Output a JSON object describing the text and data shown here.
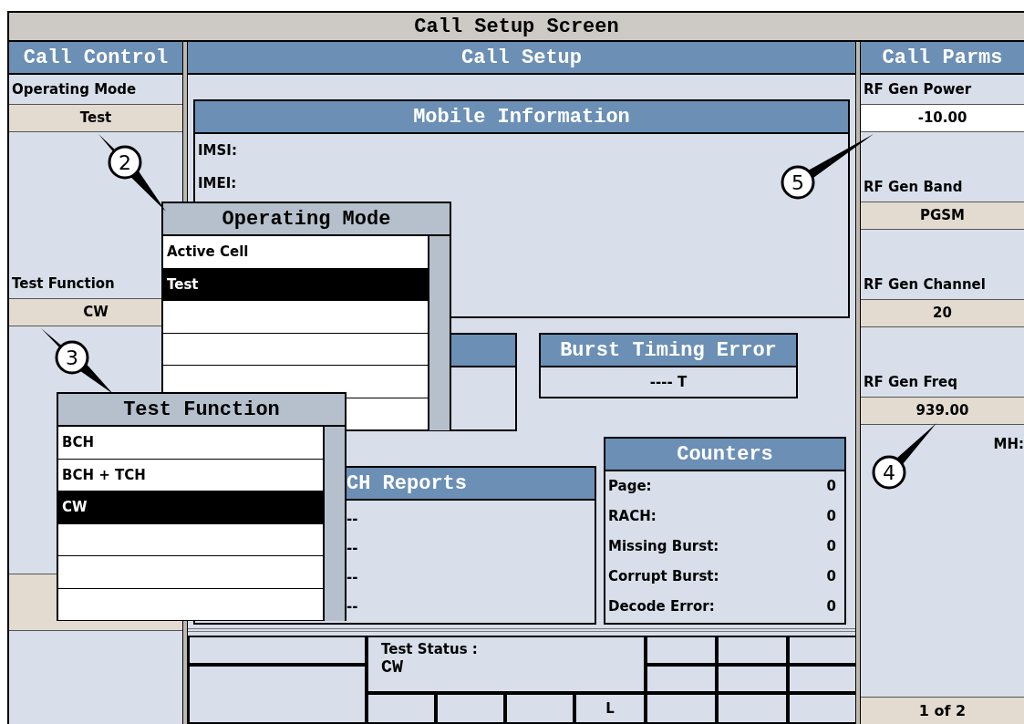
{
  "window": {
    "title": "Call Setup Screen"
  },
  "call_control": {
    "title": "Call Control",
    "fields": [
      {
        "label": "Operating Mode",
        "value": "Test"
      },
      {
        "label": "Test Function",
        "value": "CW"
      }
    ]
  },
  "call_setup": {
    "title": "Call Setup",
    "mobile_information": {
      "title": "Mobile Information",
      "rows": [
        "IMSI:",
        "IMEI:"
      ]
    },
    "burst_timing_error": {
      "title": "Burst Timing Error",
      "value": "---- T"
    },
    "reports": {
      "title": "CH Reports",
      "rows": [
        "--",
        "--",
        "--",
        "--"
      ]
    },
    "counters": {
      "title": "Counters",
      "rows": [
        {
          "label": "Page:",
          "value": "0"
        },
        {
          "label": "RACH:",
          "value": "0"
        },
        {
          "label": "Missing Burst:",
          "value": "0"
        },
        {
          "label": "Corrupt Burst:",
          "value": "0"
        },
        {
          "label": "Decode Error:",
          "value": "0"
        }
      ]
    }
  },
  "status": {
    "label": "Test Status :",
    "value": "CW",
    "indicator": "L"
  },
  "call_parms": {
    "title": "Call Parms",
    "fields": [
      {
        "label": "RF Gen Power",
        "value": "-10.00",
        "active": true
      },
      {
        "label": "RF Gen Band",
        "value": "PGSM",
        "active": false
      },
      {
        "label": "RF Gen Channel",
        "value": "20",
        "active": false
      },
      {
        "label": "RF Gen Freq",
        "value": "939.00",
        "active": false
      }
    ],
    "unit": "MH:",
    "page": "1 of 2"
  },
  "popups": [
    {
      "title": "Operating Mode",
      "options": [
        {
          "label": "Active Cell",
          "selected": false
        },
        {
          "label": "Test",
          "selected": true
        }
      ]
    },
    {
      "title": "Test Function",
      "options": [
        {
          "label": "BCH",
          "selected": false
        },
        {
          "label": "BCH + TCH",
          "selected": false
        },
        {
          "label": "CW",
          "selected": true
        }
      ]
    }
  ],
  "callouts": [
    {
      "label": "2"
    },
    {
      "label": "3"
    },
    {
      "label": "4"
    },
    {
      "label": "5"
    }
  ]
}
